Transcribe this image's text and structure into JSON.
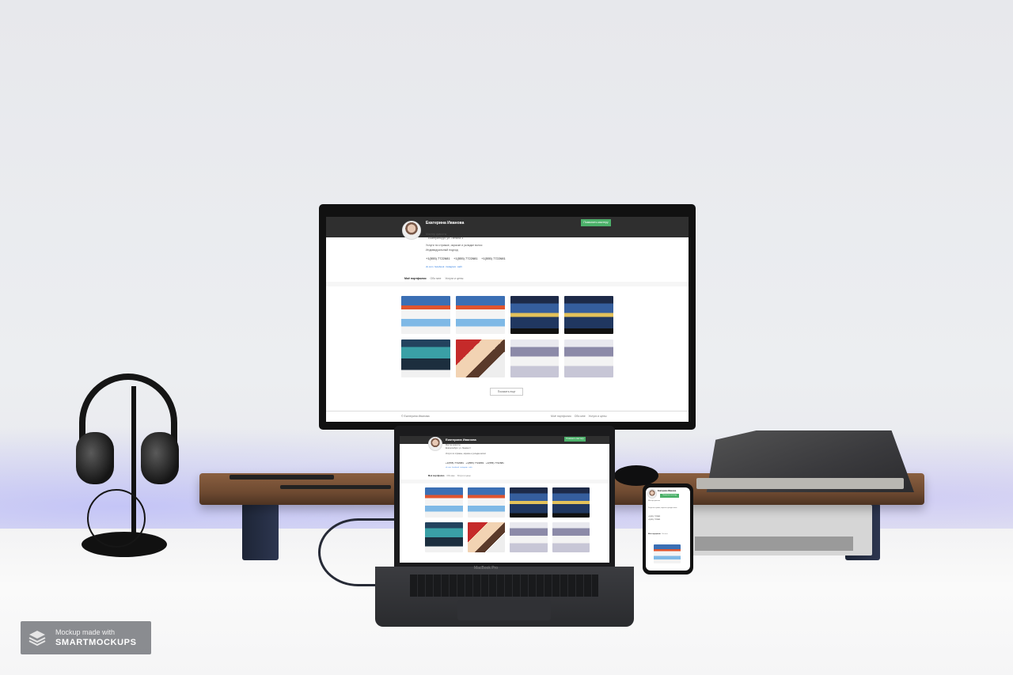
{
  "profile": {
    "name": "Екатерина Иванова",
    "contact_button": "Позвонить мастеру",
    "role": "Мастер красоты",
    "location": "Екатеринбург, ул. Ленина 3",
    "description": "Услуги по стрижке, окраске и укладке волос",
    "description2": "Индивидуальный подход",
    "phones": [
      "+1(555) 7722681",
      "+1(555) 7722681",
      "+1(555) 7722681"
    ],
    "links": [
      "vk.com",
      "facebook",
      "instagram",
      "сайт"
    ]
  },
  "tabs": [
    "Моё портфолио",
    "Обо мне",
    "Услуги и цены"
  ],
  "show_more": "Показать еще",
  "footer": {
    "copyright": "© Екатерина Иванова",
    "nav": [
      "Моё портфолио",
      "Обо мне",
      "Услуги и цены"
    ]
  },
  "laptop_label": "MacBook Pro",
  "badge": {
    "line1": "Mockup made with",
    "line2": "SMARTMOCKUPS"
  },
  "colors": {
    "accent_green": "#4cb16a",
    "topbar": "#2f2f2f",
    "link": "#2a7ae2"
  }
}
